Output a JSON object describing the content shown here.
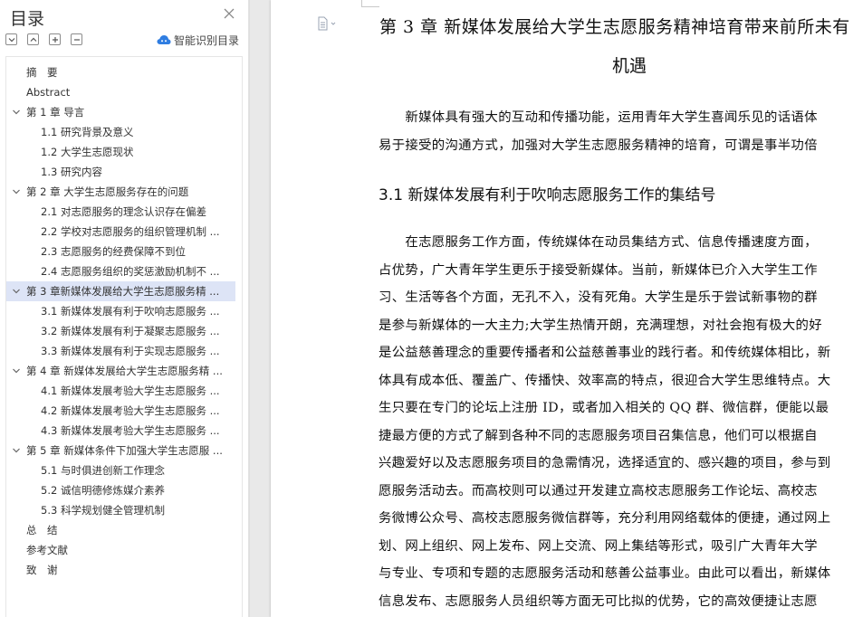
{
  "toc": {
    "title": "目录",
    "smart_label": "智能识别目录",
    "items": [
      {
        "label": "摘　要",
        "level": 0,
        "expandable": false,
        "selected": false
      },
      {
        "label": "Abstract",
        "level": 0,
        "expandable": false,
        "selected": false
      },
      {
        "label": "第 1 章  导言",
        "level": 0,
        "expandable": true,
        "selected": false
      },
      {
        "label": "1.1 研究背景及意义",
        "level": 1,
        "expandable": false,
        "selected": false
      },
      {
        "label": "1.2 大学生志愿现状",
        "level": 1,
        "expandable": false,
        "selected": false
      },
      {
        "label": "1.3 研究内容",
        "level": 1,
        "expandable": false,
        "selected": false
      },
      {
        "label": "第 2 章  大学生志愿服务存在的问题",
        "level": 0,
        "expandable": true,
        "selected": false
      },
      {
        "label": "2.1 对志愿服务的理念认识存在偏差",
        "level": 1,
        "expandable": false,
        "selected": false
      },
      {
        "label": "2.2 学校对志愿服务的组织管理机制 ...",
        "level": 1,
        "expandable": false,
        "selected": false
      },
      {
        "label": "2.3 志愿服务的经费保障不到位",
        "level": 1,
        "expandable": false,
        "selected": false
      },
      {
        "label": "2.4 志愿服务组织的奖惩激励机制不 ...",
        "level": 1,
        "expandable": false,
        "selected": false
      },
      {
        "label": "第 3 章新媒体发展给大学生志愿服务精 ...",
        "level": 0,
        "expandable": true,
        "selected": true
      },
      {
        "label": "3.1 新媒体发展有利于吹响志愿服务 ...",
        "level": 1,
        "expandable": false,
        "selected": false
      },
      {
        "label": "3.2 新媒体发展有利于凝聚志愿服务 ...",
        "level": 1,
        "expandable": false,
        "selected": false
      },
      {
        "label": "3.3 新媒体发展有利于实现志愿服务 ...",
        "level": 1,
        "expandable": false,
        "selected": false
      },
      {
        "label": "第 4 章  新媒体发展给大学生志愿服务精 ...",
        "level": 0,
        "expandable": true,
        "selected": false
      },
      {
        "label": "4.1 新媒体发展考验大学生志愿服务 ...",
        "level": 1,
        "expandable": false,
        "selected": false
      },
      {
        "label": "4.2 新媒体发展考验大学生志愿服务 ...",
        "level": 1,
        "expandable": false,
        "selected": false
      },
      {
        "label": "4.3 新媒体发展考验大学生志愿服务 ...",
        "level": 1,
        "expandable": false,
        "selected": false
      },
      {
        "label": "第 5 章  新媒体条件下加强大学生志愿服 ...",
        "level": 0,
        "expandable": true,
        "selected": false
      },
      {
        "label": "5.1 与时俱进创新工作理念",
        "level": 1,
        "expandable": false,
        "selected": false
      },
      {
        "label": "5.2 诚信明德修炼媒介素养",
        "level": 1,
        "expandable": false,
        "selected": false
      },
      {
        "label": "5.3 科学规划健全管理机制",
        "level": 1,
        "expandable": false,
        "selected": false
      },
      {
        "label": "总　结",
        "level": 0,
        "expandable": false,
        "selected": false
      },
      {
        "label": "参考文献",
        "level": 0,
        "expandable": false,
        "selected": false
      },
      {
        "label": "致　谢",
        "level": 0,
        "expandable": false,
        "selected": false
      }
    ]
  },
  "document": {
    "chapter_title_line1": "第 3 章  新媒体发展给大学生志愿服务精神培育带来前所未有",
    "chapter_title_line2": "机遇",
    "paragraph1": [
      "　　新媒体具有强大的互动和传播功能，运用青年大学生喜闻乐见的话语体",
      "易于接受的沟通方式，加强对大学生志愿服务精神的培育，可谓是事半功倍"
    ],
    "section_heading": "3.1 新媒体发展有利于吹响志愿服务工作的集结号",
    "paragraph2": [
      "　　在志愿服务工作方面，传统媒体在动员集结方式、信息传播速度方面，",
      "占优势，广大青年学生更乐于接受新媒体。当前，新媒体已介入大学生工作",
      "习、生活等各个方面，无孔不入，没有死角。大学生是乐于尝试新事物的群",
      "是参与新媒体的一大主力;大学生热情开朗，充满理想，对社会抱有极大的好",
      "是公益慈善理念的重要传播者和公益慈善事业的践行者。和传统媒体相比，新",
      "体具有成本低、覆盖广、传播快、效率高的特点，很迎合大学生思维特点。大",
      "生只要在专门的论坛上注册 ID，或者加入相关的 QQ 群、微信群，便能以最",
      "捷最方便的方式了解到各种不同的志愿服务项目召集信息，他们可以根据自",
      "兴趣爱好以及志愿服务项目的急需情况，选择适宜的、感兴趣的项目，参与到",
      "愿服务活动去。而高校则可以通过开发建立高校志愿服务工作论坛、高校志",
      "务微博公众号、高校志愿服务微信群等，充分利用网络载体的便捷，通过网上",
      "划、网上组织、网上发布、网上交流、网上集结等形式，吸引广大青年大学",
      "与专业、专项和专题的志愿服务活动和慈善公益事业。由此可以看出，新媒体",
      "信息发布、志愿服务人员组织等方面无可比拟的优势，它的高效便捷让志愿"
    ]
  },
  "colors": {
    "selection": "#dde4f6",
    "accent_icon": "#2f7de1",
    "splitter": "#e9e9e9"
  }
}
